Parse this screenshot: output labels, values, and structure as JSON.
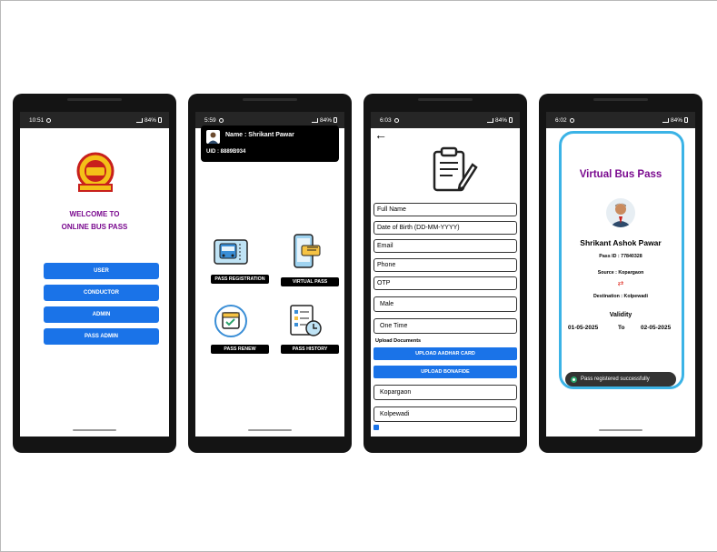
{
  "phones": [
    {
      "status": {
        "time": "10:51",
        "battery": "84%"
      },
      "welcome_line1": "WELCOME TO",
      "welcome_line2": "ONLINE BUS PASS",
      "logo_icon": "msrtc-logo-icon",
      "menu": [
        "USER",
        "CONDUCTOR",
        "ADMIN",
        "PASS ADMIN"
      ]
    },
    {
      "status": {
        "time": "5:59",
        "battery": "84%"
      },
      "user_name": "Name : Shrikant Pawar",
      "uid": "UID : 8889B934",
      "tiles": [
        {
          "label": "PASS REGISTRATION",
          "icon": "bus-ticket-icon"
        },
        {
          "label": "VIRTUAL PASS",
          "icon": "mobile-ticket-icon"
        },
        {
          "label": "PASS RENEW",
          "icon": "calendar-renew-icon"
        },
        {
          "label": "PASS HISTORY",
          "icon": "checklist-clock-icon"
        }
      ]
    },
    {
      "status": {
        "time": "6:03",
        "battery": "84%"
      },
      "back_glyph": "←",
      "fields": [
        "Full Name",
        "Date of Birth (DD-MM-YYYY)",
        "Email",
        "Phone",
        "OTP"
      ],
      "gender": "Male",
      "pass_type": "One Time",
      "upload_label": "Upload Documents",
      "upload_aadhar": "UPLOAD AADHAR CARD",
      "upload_bonafide": "UPLOAD BONAFIDE",
      "source": "Kopargaon",
      "destination": "Kolpewadi"
    },
    {
      "status": {
        "time": "6:02",
        "battery": "84%"
      },
      "title": "Virtual Bus Pass",
      "name": "Shrikant Ashok Pawar",
      "pass_id": "Pass ID : 77840328",
      "source": "Source : Kopargaon",
      "destination": "Destination : Kolpewadi",
      "validity_label": "Validity",
      "from_date": "01-05-2025",
      "to_label": "To",
      "to_date": "02-05-2025",
      "toast": "Pass registered successfully"
    }
  ],
  "colors": {
    "primary_blue": "#1a73e8",
    "purple_title": "#7a0a8f",
    "card_border": "#3bb3e6",
    "device_body": "#141414"
  }
}
